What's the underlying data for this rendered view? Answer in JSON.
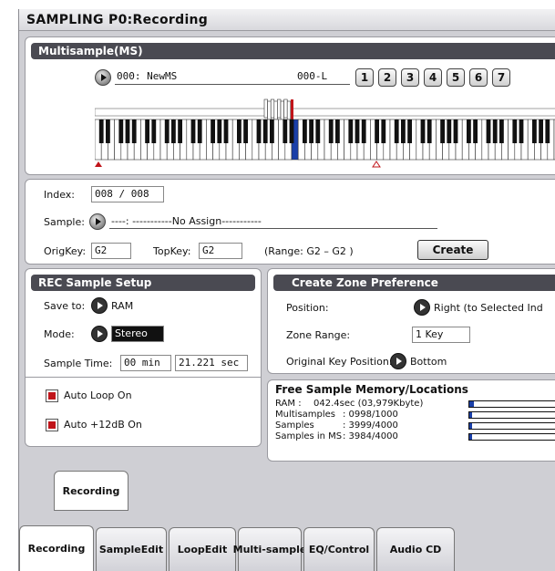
{
  "title": "SAMPLING P0:Recording",
  "multisample": {
    "header": "Multisample(MS)",
    "ms_name": "000: NewMS",
    "ms_suffix": "000-L",
    "zone_buttons": [
      "1",
      "2",
      "3",
      "4",
      "5",
      "6",
      "7"
    ]
  },
  "index": {
    "label": "Index:",
    "value": "008 / 008",
    "sample_label": "Sample:",
    "sample_value": "----: -----------No Assign-----------",
    "origkey_label": "OrigKey:",
    "origkey_value": "G2",
    "topkey_label": "TopKey:",
    "topkey_value": "G2",
    "range_text": "(Range: G2  – G2  )",
    "create_label": "Create"
  },
  "rec_setup": {
    "header": "REC Sample Setup",
    "save_to_label": "Save to:",
    "save_to_value": "RAM",
    "mode_label": "Mode:",
    "mode_value": "Stereo",
    "sample_time_label": "Sample Time:",
    "sample_time_min": "00 min",
    "sample_time_sec": "21.221 sec",
    "auto_loop_label": "Auto Loop On",
    "auto_12db_label": "Auto +12dB On"
  },
  "zone_pref": {
    "header": "Create Zone Preference",
    "position_label": "Position:",
    "position_value": "Right (to Selected Ind",
    "zone_range_label": "Zone Range:",
    "zone_range_value": "1 Key",
    "orig_key_pos_label": "Original Key Position:",
    "orig_key_pos_value": "Bottom"
  },
  "free_memory": {
    "title": "Free Sample Memory/Locations",
    "rows": [
      {
        "label": "RAM :",
        "value": "042.4sec  (03,979Kbyte)",
        "fill": 0.04
      },
      {
        "label": "Multisamples",
        "value": ": 0998/1000",
        "fill": 0.02
      },
      {
        "label": "Samples",
        "value": ": 3999/4000",
        "fill": 0.02
      },
      {
        "label": "Samples in MS",
        "value": ": 3984/4000",
        "fill": 0.02
      }
    ]
  },
  "subtab": "Recording",
  "tabs": [
    {
      "line1": "Recording",
      "line2": ""
    },
    {
      "line1": "Sample",
      "line2": "Edit"
    },
    {
      "line1": "Loop",
      "line2": "Edit"
    },
    {
      "line1": "Multi-",
      "line2": "sample"
    },
    {
      "line1": "EQ/",
      "line2": "Control"
    },
    {
      "line1": "Audio CD",
      "line2": ""
    }
  ],
  "colors": {
    "accent_red": "#c0141a",
    "key_selected": "#1a3fa8",
    "header_bg": "#4a4a52"
  }
}
